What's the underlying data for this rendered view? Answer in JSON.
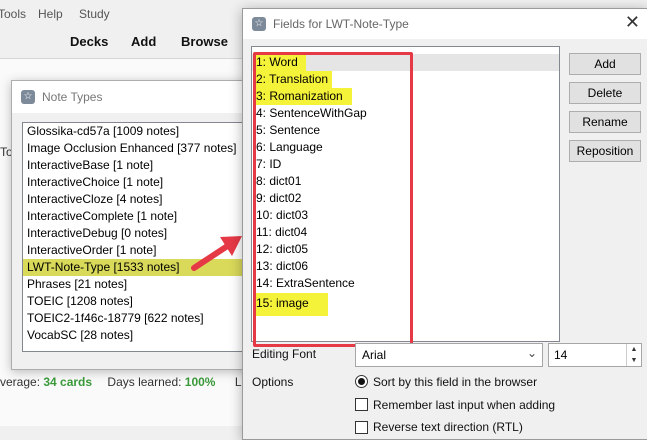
{
  "main": {
    "menu": [
      "Tools",
      "Help",
      "Study"
    ],
    "toolbar": [
      "Decks",
      "Add",
      "Browse"
    ],
    "side_label": "To",
    "stats": {
      "average_prefix": "verage: ",
      "average_value": "34 cards",
      "days_prefix": "Days learned: ",
      "days_value": "100%",
      "longest": "Long"
    }
  },
  "note_types": {
    "title": "Note Types",
    "items": [
      "Glossika-cd57a [1009 notes]",
      "Image Occlusion Enhanced [377 notes]",
      "InteractiveBase [1 note]",
      "InteractiveChoice [1 note]",
      "InteractiveCloze [4 notes]",
      "InteractiveComplete [1 note]",
      "InteractiveDebug [0 notes]",
      "InteractiveOrder [1 note]",
      "LWT-Note-Type [1533 notes]",
      "Phrases [21 notes]",
      "TOEIC [1208 notes]",
      "TOEIC2-1f46c-18779 [622 notes]",
      "VocabSC [28 notes]"
    ],
    "selected_index": 8
  },
  "fields_dialog": {
    "title": "Fields for LWT-Note-Type",
    "fields": [
      "1: Word",
      "2: Translation",
      "3: Romanization",
      "4: SentenceWithGap",
      "5: Sentence",
      "6: Language",
      "7: ID",
      "8: dict01",
      "9: dict02",
      "10: dict03",
      "11: dict04",
      "12: dict05",
      "13: dict06",
      "14: ExtraSentence",
      "15: image"
    ],
    "highlighted_indices": [
      0,
      1,
      2,
      14
    ],
    "buttons": {
      "add": "Add",
      "delete": "Delete",
      "rename": "Rename",
      "reposition": "Reposition"
    },
    "editing_font_label": "Editing Font",
    "font_value": "Arial",
    "font_size": "14",
    "options_label": "Options",
    "sort_option": "Sort by this field in the browser",
    "remember_option": "Remember last input when adding",
    "reverse_option": "Reverse text direction (RTL)"
  },
  "colors": {
    "highlight_yellow": "#f5f23a",
    "annotation_red": "#e63946",
    "selection_olive": "#d9d95a"
  }
}
